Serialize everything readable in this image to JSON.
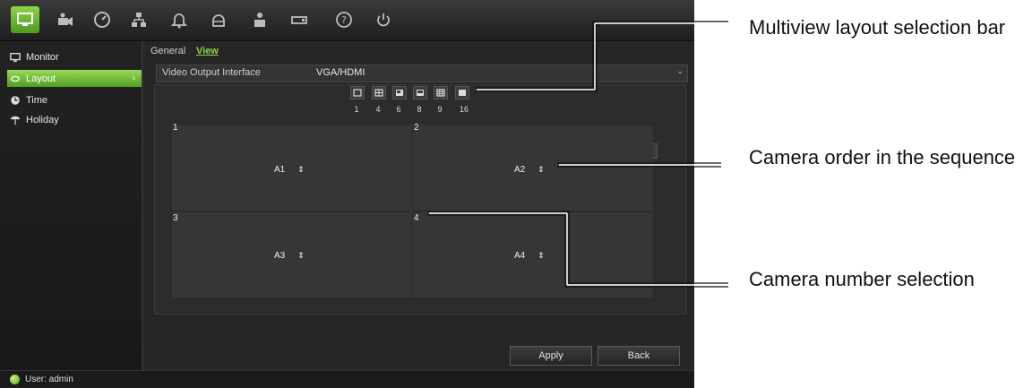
{
  "sidebar": {
    "items": [
      {
        "label": "Monitor",
        "icon": "monitor-icon"
      },
      {
        "label": "Layout",
        "icon": "layout-icon",
        "active": true
      },
      {
        "label": "Time",
        "icon": "clock-icon"
      },
      {
        "label": "Holiday",
        "icon": "holiday-icon"
      }
    ]
  },
  "tabs": {
    "general": "General",
    "view": "View"
  },
  "video_output": {
    "label": "Video Output Interface",
    "value": "VGA/HDMI"
  },
  "layout_bar": {
    "options": [
      "1",
      "4",
      "6",
      "8",
      "9",
      "16"
    ]
  },
  "nav": {
    "prev": "<",
    "next": ">"
  },
  "cells": [
    {
      "number": "1",
      "camera": "A1"
    },
    {
      "number": "2",
      "camera": "A2"
    },
    {
      "number": "3",
      "camera": "A3"
    },
    {
      "number": "4",
      "camera": "A4"
    }
  ],
  "buttons": {
    "apply": "Apply",
    "back": "Back"
  },
  "status": {
    "user": "User: admin"
  },
  "annotations": {
    "layout_bar": "Multiview layout selection bar",
    "camera_order": "Camera order in the sequence",
    "camera_number": "Camera number selection"
  },
  "colors": {
    "accent": "#6fbf2f",
    "background": "#2a2a2a"
  }
}
